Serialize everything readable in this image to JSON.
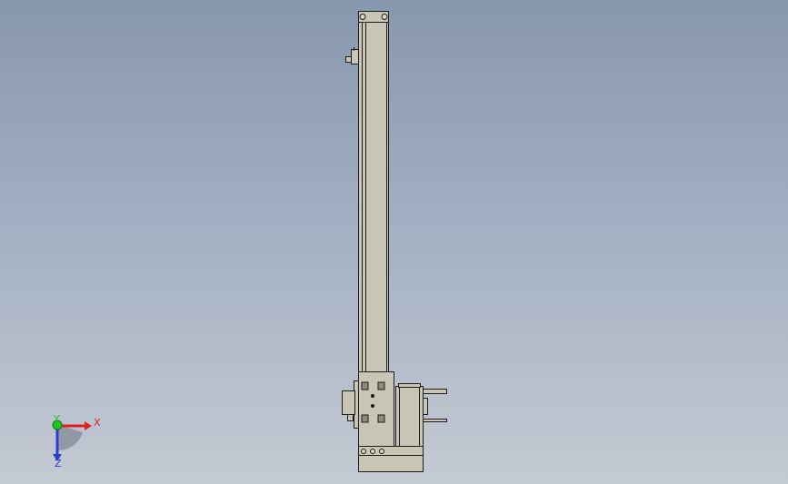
{
  "viewport": {
    "background_top": "#8797ad",
    "background_bottom": "#c4cad3"
  },
  "model": {
    "body_color": "#c9c6b6",
    "edge_color": "#1c1c1c",
    "shade_color": "#a9a696"
  },
  "triad": {
    "x_label": "X",
    "y_label": "Y",
    "z_label": "Z",
    "x_color": "#e0201c",
    "y_color": "#1fc51f",
    "z_color": "#2a3bd6"
  }
}
